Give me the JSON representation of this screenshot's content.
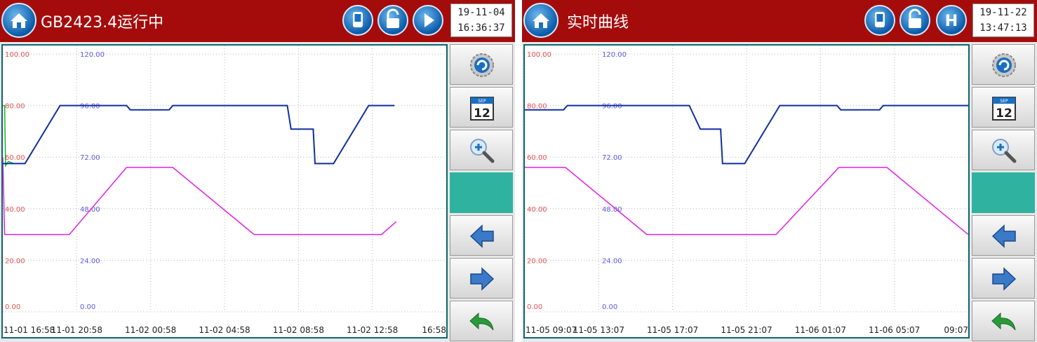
{
  "colors": {
    "header_bg": "#a40c0c",
    "accent_teal": "#2fb3a0",
    "left_axis": "#e05050",
    "right_axis": "#5a5ae0",
    "series_blue": "#1030a0",
    "series_green": "#20b020",
    "series_magenta": "#e020e0"
  },
  "panels": [
    {
      "title": "GB2423.4运行中",
      "clock_date": "19-11-04",
      "clock_time": "16:36:37",
      "status_icons": [
        "device-icon",
        "unlock-icon",
        "play-icon"
      ],
      "sidebar": [
        "settings-gear-icon",
        "calendar-icon",
        "zoom-in-icon",
        "",
        "arrow-left-icon",
        "arrow-right-icon",
        "return-icon"
      ],
      "calendar_day": "12",
      "calendar_month": "SEP",
      "chart_data": {
        "type": "line",
        "left_axis": {
          "ticks": [
            "0.00",
            "20.00",
            "40.00",
            "60.00",
            "80.00",
            "100.00"
          ],
          "range": [
            0,
            100
          ]
        },
        "right_axis": {
          "ticks": [
            "0.00",
            "24.00",
            "48.00",
            "72.00",
            "96.00",
            "120.00"
          ],
          "range": [
            0,
            120
          ]
        },
        "x_ticks": [
          "11-01 16:58",
          "11-01 20:58",
          "11-02 00:58",
          "11-02 04:58",
          "11-02 08:58",
          "11-02 12:58",
          "16:58"
        ],
        "x_range": [
          0,
          24
        ],
        "grid": "dotted",
        "series": [
          {
            "color": "#1030a0",
            "axis": "right",
            "points": [
              [
                0,
                69
              ],
              [
                1.2,
                69
              ],
              [
                3.1,
                96
              ],
              [
                6.7,
                96
              ],
              [
                6.9,
                94
              ],
              [
                9.0,
                94
              ],
              [
                9.2,
                96
              ],
              [
                15.4,
                96
              ],
              [
                15.6,
                85
              ],
              [
                16.8,
                85
              ],
              [
                16.9,
                69
              ],
              [
                17.9,
                69
              ],
              [
                19.8,
                96
              ],
              [
                21.2,
                96
              ]
            ]
          },
          {
            "color": "#20b020",
            "axis": "right",
            "points": [
              [
                0,
                96
              ],
              [
                0.1,
                96
              ],
              [
                0.15,
                68
              ],
              [
                0.3,
                70
              ],
              [
                0.6,
                69
              ],
              [
                1.2,
                69
              ],
              [
                3.1,
                96
              ],
              [
                6.7,
                96
              ],
              [
                6.9,
                94
              ],
              [
                9.0,
                94
              ],
              [
                9.2,
                96
              ],
              [
                15.4,
                96
              ],
              [
                15.6,
                85
              ],
              [
                16.8,
                85
              ],
              [
                16.9,
                69
              ],
              [
                17.9,
                69
              ],
              [
                19.8,
                96
              ],
              [
                21.2,
                96
              ]
            ]
          },
          {
            "color": "#e020e0",
            "axis": "left",
            "points": [
              [
                0,
                60
              ],
              [
                0.1,
                30
              ],
              [
                3.6,
                30
              ],
              [
                6.7,
                56
              ],
              [
                9.2,
                56
              ],
              [
                13.6,
                30
              ],
              [
                20.5,
                30
              ],
              [
                21.3,
                35
              ]
            ]
          }
        ]
      }
    },
    {
      "title": "实时曲线",
      "clock_date": "19-11-22",
      "clock_time": "13:47:13",
      "status_icons": [
        "device-icon",
        "unlock-icon",
        "hold-icon"
      ],
      "hold_letter": "H",
      "sidebar": [
        "settings-gear-icon",
        "calendar-icon",
        "zoom-in-icon",
        "",
        "arrow-left-icon",
        "arrow-right-icon",
        "return-icon"
      ],
      "calendar_day": "12",
      "calendar_month": "SEP",
      "chart_data": {
        "type": "line",
        "left_axis": {
          "ticks": [
            "0.00",
            "20.00",
            "40.00",
            "60.00",
            "80.00",
            "100.00"
          ],
          "range": [
            0,
            100
          ]
        },
        "right_axis": {
          "ticks": [
            "0.00",
            "24.00",
            "48.00",
            "72.00",
            "96.00",
            "120.00"
          ],
          "range": [
            0,
            120
          ]
        },
        "x_ticks": [
          "11-05 09:07",
          "11-05 13:07",
          "11-05 17:07",
          "11-05 21:07",
          "11-06 01:07",
          "11-06 05:07",
          "09:07"
        ],
        "x_range": [
          0,
          24
        ],
        "grid": "dotted",
        "series": [
          {
            "color": "#1030a0",
            "axis": "right",
            "points": [
              [
                0,
                94
              ],
              [
                0.15,
                94
              ],
              [
                2.1,
                94
              ],
              [
                2.3,
                96
              ],
              [
                8.9,
                96
              ],
              [
                9.5,
                85
              ],
              [
                10.6,
                85
              ],
              [
                10.7,
                69
              ],
              [
                11.9,
                69
              ],
              [
                13.8,
                96
              ],
              [
                16.9,
                96
              ],
              [
                17.1,
                94
              ],
              [
                19.2,
                94
              ],
              [
                19.4,
                96
              ],
              [
                24,
                96
              ]
            ]
          },
          {
            "color": "#20b020",
            "axis": "right",
            "points": [
              [
                0,
                94
              ],
              [
                2.1,
                94
              ],
              [
                2.3,
                96
              ],
              [
                8.9,
                96
              ],
              [
                9.5,
                85
              ],
              [
                10.6,
                85
              ],
              [
                10.7,
                69
              ],
              [
                11.9,
                69
              ],
              [
                13.8,
                96
              ],
              [
                16.9,
                96
              ],
              [
                17.1,
                94
              ],
              [
                19.2,
                94
              ],
              [
                19.4,
                96
              ],
              [
                24,
                96
              ]
            ]
          },
          {
            "color": "#e020e0",
            "axis": "left",
            "points": [
              [
                0,
                56
              ],
              [
                2.2,
                56
              ],
              [
                6.6,
                30
              ],
              [
                13.6,
                30
              ],
              [
                17.0,
                56
              ],
              [
                19.6,
                56
              ],
              [
                24,
                30
              ]
            ]
          }
        ]
      }
    }
  ]
}
